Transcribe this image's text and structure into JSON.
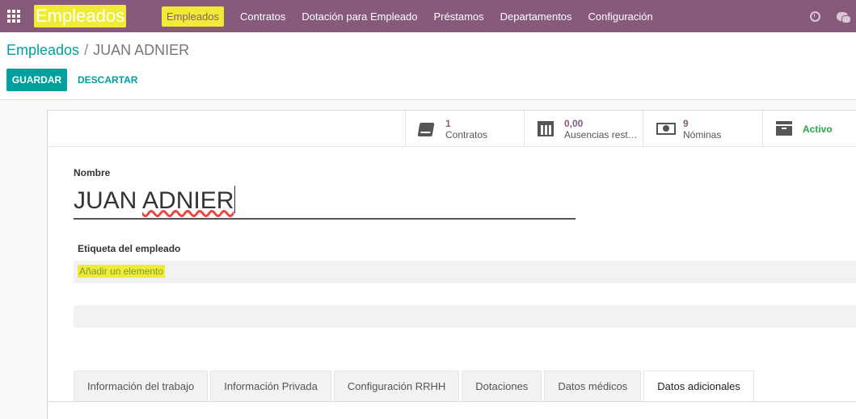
{
  "navbar": {
    "brand": "Empleados",
    "menu": [
      "Empleados",
      "Contratos",
      "Dotación para Empleado",
      "Préstamos",
      "Departamentos",
      "Configuración"
    ]
  },
  "breadcrumb": {
    "parent": "Empleados",
    "separator": "/",
    "current": "JUAN ADNIER"
  },
  "actions": {
    "save": "GUARDAR",
    "discard": "DESCARTAR"
  },
  "stats": [
    {
      "value": "1",
      "label": "Contratos",
      "icon": "book-icon"
    },
    {
      "value": "0,00",
      "label": "Ausencias rest…",
      "icon": "calendar-icon"
    },
    {
      "value": "9",
      "label": "Nóminas",
      "icon": "money-icon"
    },
    {
      "value": "",
      "label": "Activo",
      "icon": "archive-icon"
    }
  ],
  "form": {
    "name_label": "Nombre",
    "name_value": "JUAN ADNIER",
    "tag_label": "Etiqueta del empleado",
    "add_element": "Añadir un elemento"
  },
  "tabs": [
    "Información del trabajo",
    "Información Privada",
    "Configuración RRHH",
    "Dotaciones",
    "Datos médicos",
    "Datos adicionales"
  ],
  "colors": {
    "brand": "#875a7b",
    "accent": "#00a09d",
    "highlight": "#f0ec36",
    "active_status": "#28a745"
  }
}
